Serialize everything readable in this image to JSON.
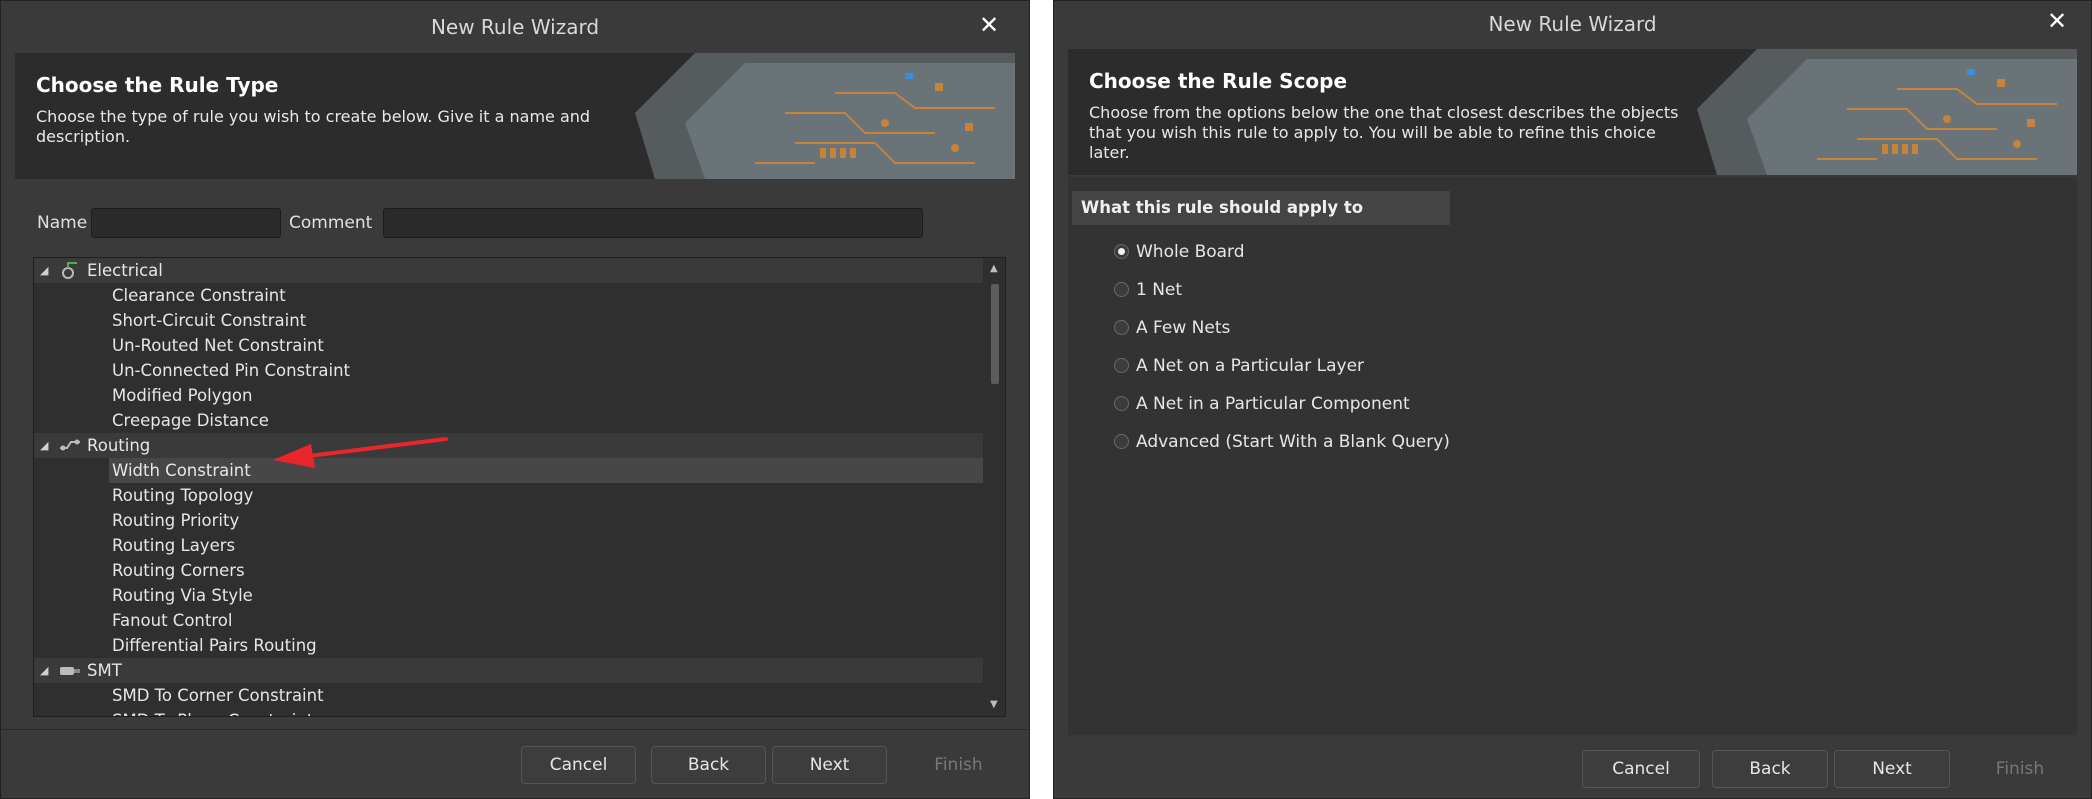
{
  "left_dialog": {
    "title": "New Rule Wizard",
    "close_glyph": "✕",
    "banner": {
      "heading": "Choose the Rule Type",
      "description": "Choose the type of rule you wish to create below. Give it a name and description."
    },
    "form": {
      "name_label": "Name",
      "name_value": "",
      "comment_label": "Comment",
      "comment_value": ""
    },
    "tree": {
      "groups": [
        {
          "label": "Electrical",
          "icon": "electrical-icon",
          "items": [
            "Clearance Constraint",
            "Short-Circuit Constraint",
            "Un-Routed Net Constraint",
            "Un-Connected Pin Constraint",
            "Modified Polygon",
            "Creepage Distance"
          ]
        },
        {
          "label": "Routing",
          "icon": "routing-icon",
          "items": [
            "Width Constraint",
            "Routing Topology",
            "Routing Priority",
            "Routing Layers",
            "Routing Corners",
            "Routing Via Style",
            "Fanout Control",
            "Differential Pairs Routing"
          ]
        },
        {
          "label": "SMT",
          "icon": "smt-icon",
          "items": [
            "SMD To Corner Constraint",
            "SMD To Plane Constraint"
          ]
        }
      ],
      "selected_item": "Width Constraint"
    },
    "annotation": "red-arrow-pointing-to-width-constraint",
    "buttons": {
      "cancel": "Cancel",
      "back": "Back",
      "next": "Next",
      "finish": "Finish"
    }
  },
  "right_dialog": {
    "title": "New Rule Wizard",
    "close_glyph": "✕",
    "banner": {
      "heading": "Choose the Rule Scope",
      "description": "Choose from the options below the one that closest describes the objects that you wish this rule to apply to. You will be able to refine this choice later."
    },
    "scope_header": "What this rule should apply to",
    "options": [
      {
        "label": "Whole Board",
        "selected": true
      },
      {
        "label": "1 Net",
        "selected": false
      },
      {
        "label": "A Few Nets",
        "selected": false
      },
      {
        "label": "A Net on a Particular Layer",
        "selected": false
      },
      {
        "label": "A Net in a Particular Component",
        "selected": false
      },
      {
        "label": "Advanced (Start With a Blank Query)",
        "selected": false
      }
    ],
    "buttons": {
      "cancel": "Cancel",
      "back": "Back",
      "next": "Next",
      "finish": "Finish"
    }
  },
  "colors": {
    "dialog_bg": "#3a3a3a",
    "banner_bg": "#2c2c2c",
    "annotation_arrow": "#e8262b",
    "pcb_accent": "#c8833a"
  }
}
